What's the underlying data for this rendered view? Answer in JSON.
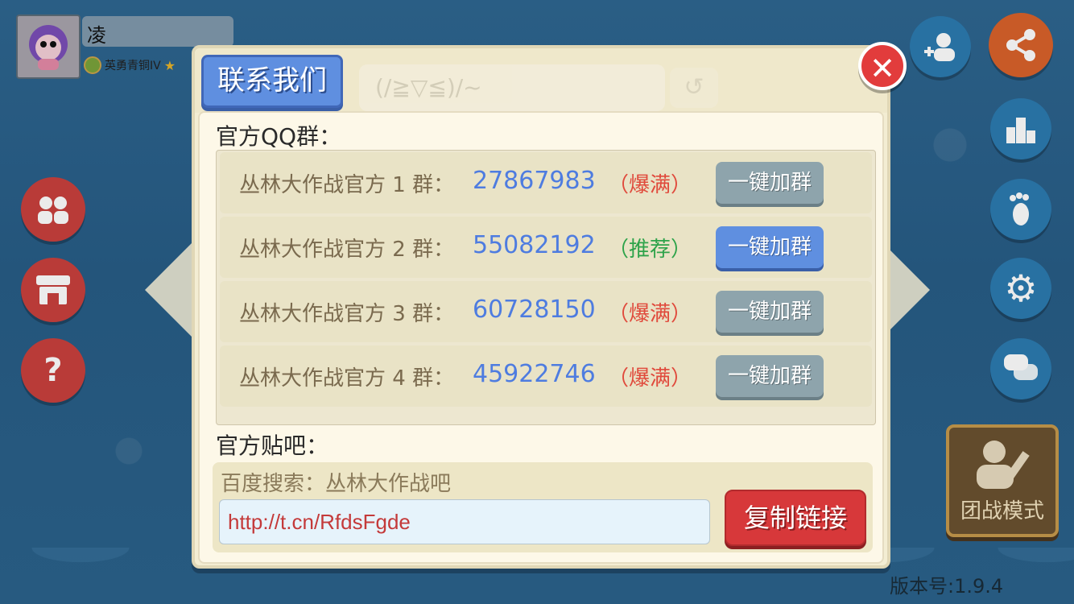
{
  "player": {
    "name": "凌",
    "rank": "英勇青铜IV"
  },
  "dialog": {
    "title": "联系我们",
    "background_input_text": "(/≧▽≦)/~",
    "qq_section_label": "官方QQ群：",
    "groups": [
      {
        "label": "丛林大作战官方 1 群：",
        "number": "27867983",
        "status": "（爆满）",
        "status_color": "#e04a3c",
        "button": "一键加群",
        "button_style": "gray"
      },
      {
        "label": "丛林大作战官方 2 群：",
        "number": "55082192",
        "status": "（推荐）",
        "status_color": "#2ea34a",
        "button": "一键加群",
        "button_style": "blue"
      },
      {
        "label": "丛林大作战官方 3 群：",
        "number": "60728150",
        "status": "（爆满）",
        "status_color": "#e04a3c",
        "button": "一键加群",
        "button_style": "gray"
      },
      {
        "label": "丛林大作战官方 4 群：",
        "number": "45922746",
        "status": "（爆满）",
        "status_color": "#e04a3c",
        "button": "一键加群",
        "button_style": "gray"
      }
    ],
    "tieba_section_label": "官方贴吧：",
    "tieba_hint": "百度搜索：丛林大作战吧",
    "link_value": "http://t.cn/RfdsFgde",
    "copy_button": "复制链接"
  },
  "side": {
    "mode_label": "团战模式",
    "version": "版本号:1.9.4"
  },
  "icons": {
    "left": [
      "friends-icon",
      "shop-icon",
      "help-icon"
    ],
    "right": [
      "share-icon",
      "add-friend-icon",
      "leaderboard-icon",
      "footprint-icon",
      "settings-icon",
      "chat-icon"
    ]
  }
}
